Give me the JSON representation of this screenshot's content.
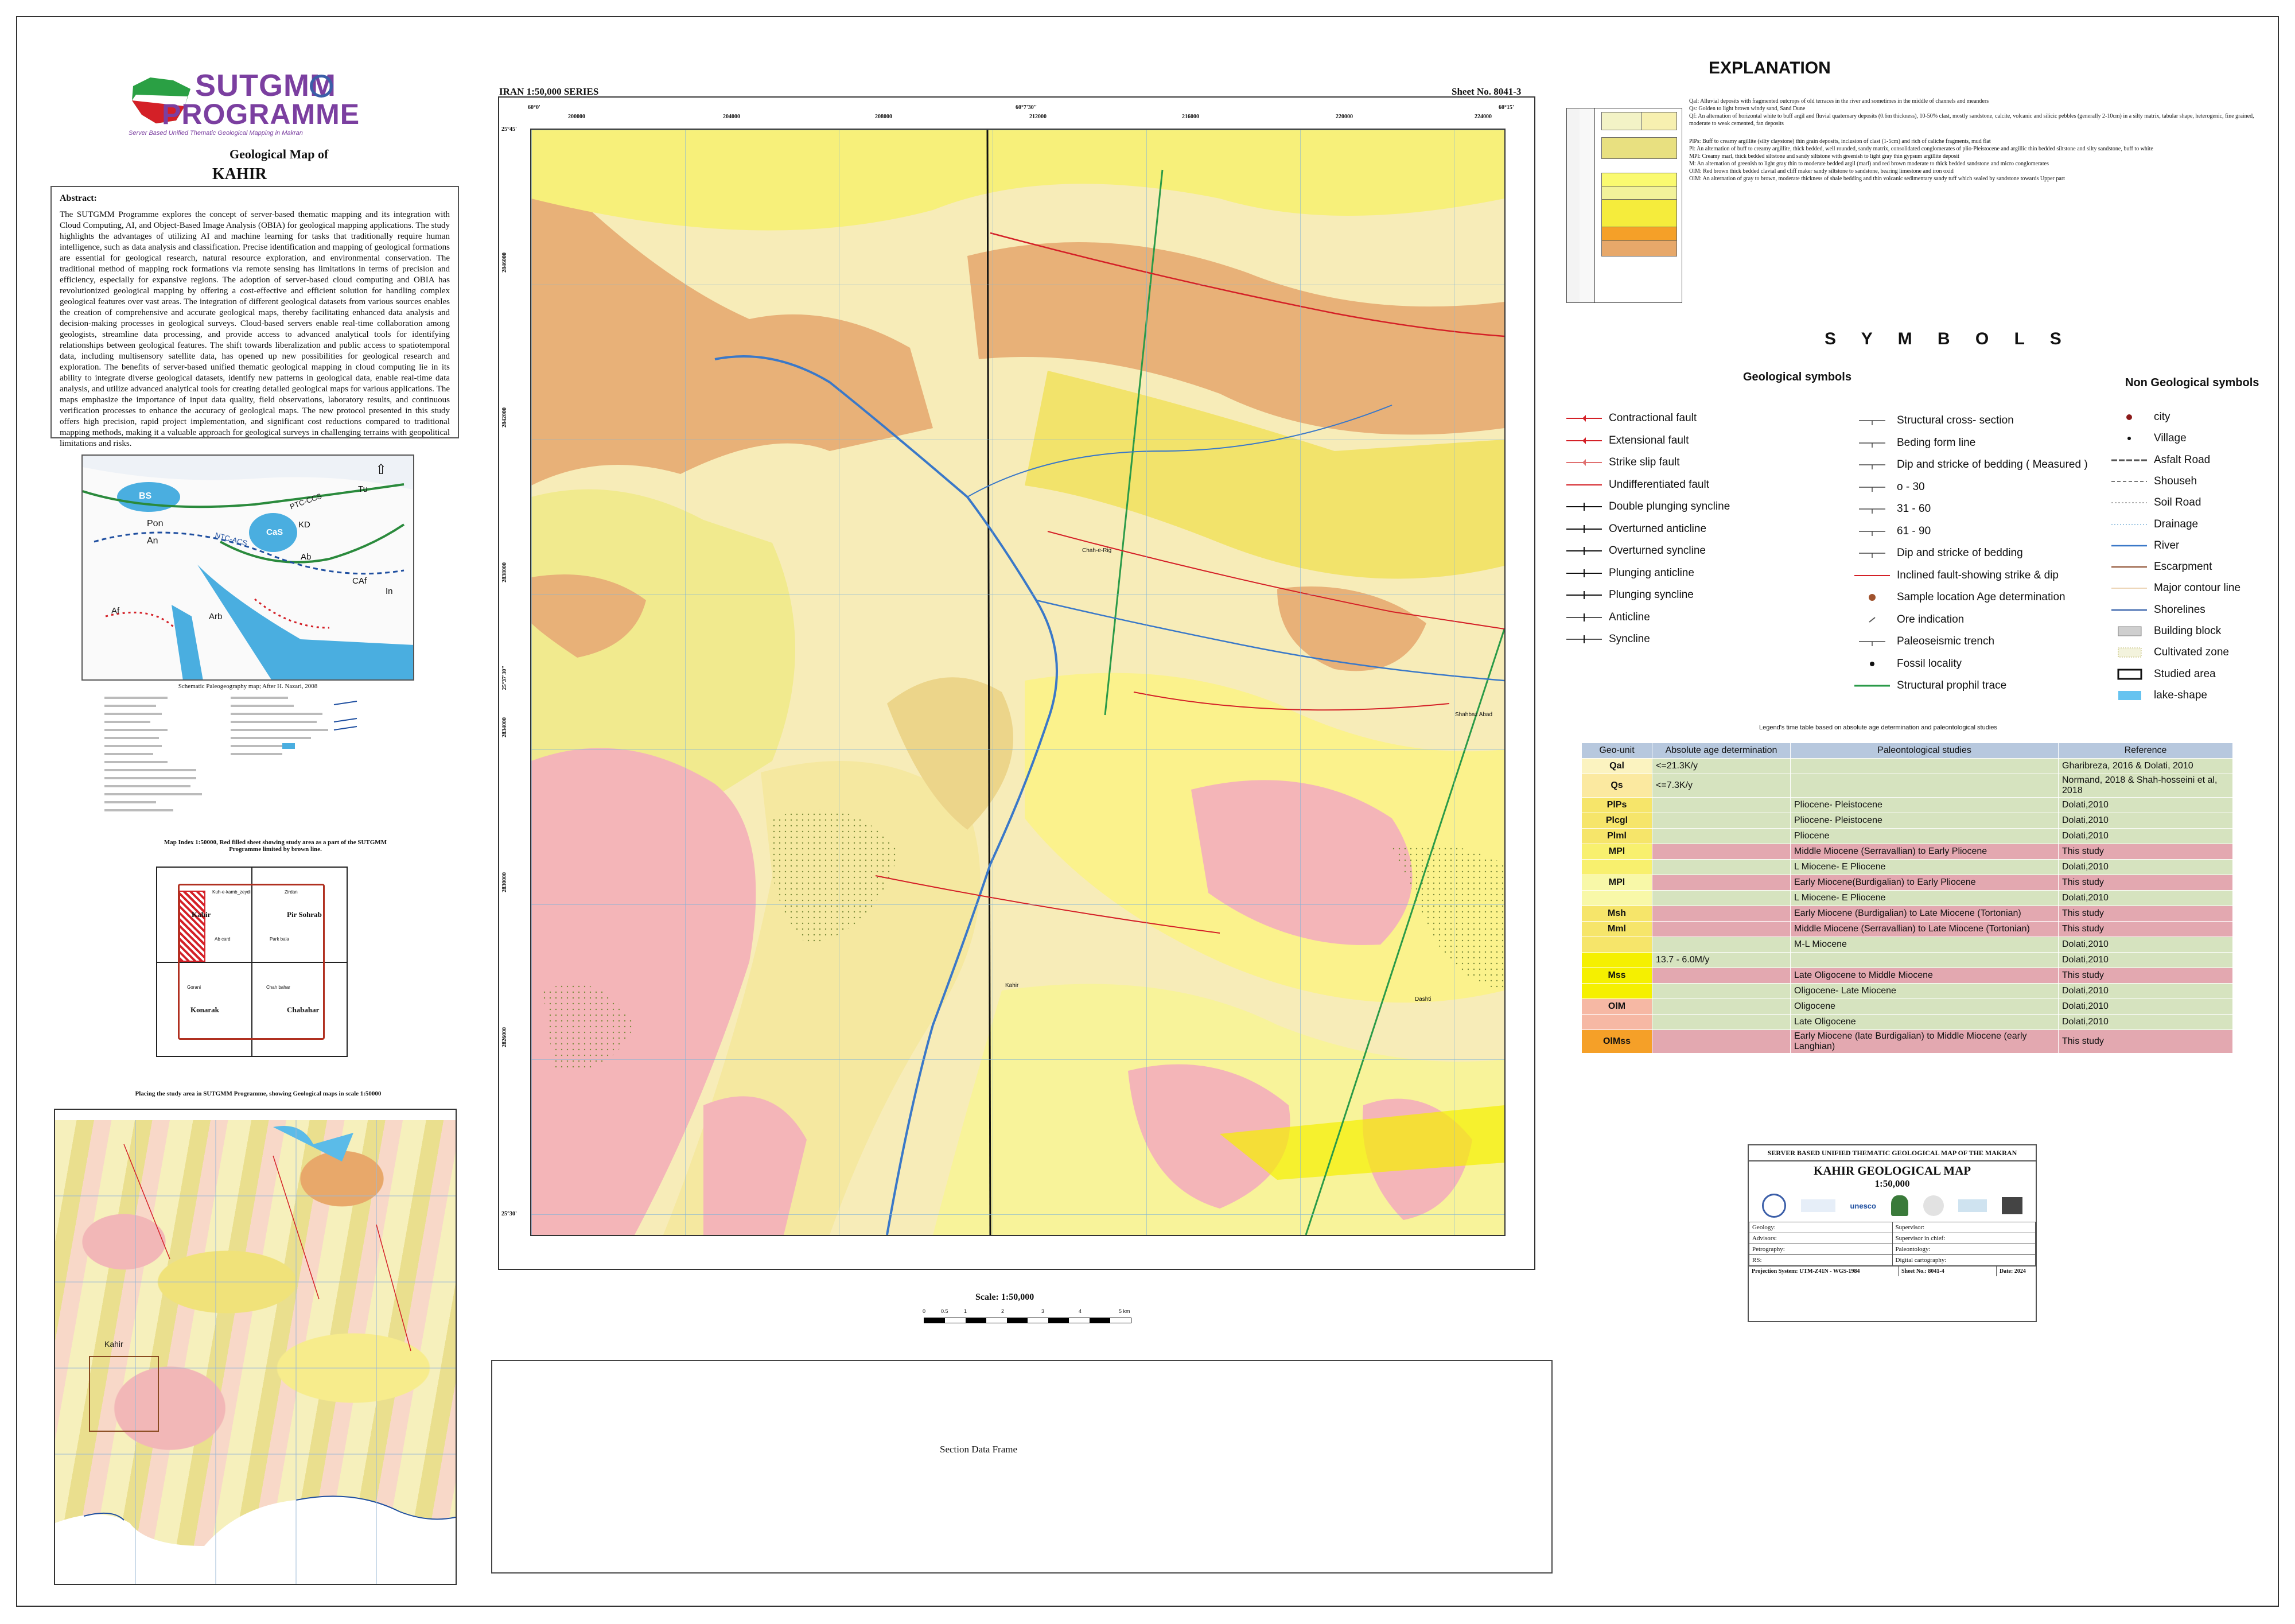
{
  "programme": {
    "logo_line1": "SUTGMM",
    "logo_line2": "PROGRAMME",
    "tagline": "Server Based Unified Thematic Geological Mapping in Makran"
  },
  "map_title": {
    "line1": "Geological Map of",
    "line2": "KAHIR"
  },
  "abstract": {
    "heading": "Abstract:",
    "text": "The SUTGMM Programme explores the concept of server-based thematic mapping and its integration with Cloud Computing, AI, and Object-Based Image Analysis (OBIA) for geological mapping applications. The study highlights the advantages of utilizing AI and machine learning for tasks that traditionally require human intelligence, such as data analysis and classification. Precise identification and mapping of geological formations are essential for geological research, natural resource exploration, and environmental conservation. The traditional method of mapping rock formations via remote sensing has limitations in terms of precision and efficiency, especially for expansive regions. The adoption of server-based cloud computing and OBIA has revolutionized geological mapping by offering a cost-effective and efficient solution for handling complex geological features over vast areas. The integration of different geological datasets from various sources enables the creation of comprehensive and accurate geological maps, thereby facilitating enhanced data analysis and decision-making processes in geological surveys. Cloud-based servers enable real-time collaboration among geologists, streamline data processing, and provide access to advanced analytical tools for identifying relationships between geological features. The shift towards liberalization and public access to spatiotemporal data, including multisensory satellite data, has opened up new possibilities for geological research and exploration. The benefits of server-based unified thematic geological mapping in cloud computing lie in its ability to integrate diverse geological datasets, identify new patterns in geological data, enable real-time data analysis, and utilize advanced analytical tools for creating detailed geological maps for various applications. The maps emphasize the importance of input data quality, field observations, laboratory results, and continuous verification processes to enhance the accuracy of geological maps. The new protocol presented in this study offers high precision, rapid project implementation, and significant cost reductions compared to traditional mapping methods, making it a valuable approach for geological surveys in challenging terrains with geopolitical limitations and risks."
  },
  "paleo_caption": "Schematic Paleogeography map; After H. Nazari, 2008",
  "paleo_labels": [
    "BS",
    "Pon",
    "An",
    "CaS",
    "KD",
    "Ab",
    "CAf",
    "Tu",
    "In",
    "Af",
    "Arb",
    "PTC-CCS",
    "NTC-ACS"
  ],
  "index_map": {
    "caption": "Map Index 1:50000, Red filled sheet showing study area as a part of the SUTGMM Programme limited by brown line.",
    "cells": [
      "Kahir",
      "Pir Sohrab",
      "Konarak",
      "Chabahar"
    ],
    "small_labels": [
      "Kuh-e-kamb_zeydi",
      "Zirdan",
      "Ab card",
      "Park bala",
      "Gorani",
      "Chah bahar"
    ]
  },
  "regional_caption": "Placing the study area in SUTGMM Programme, showing Geological maps in scale 1:50000",
  "regional_label": "Kahir",
  "map": {
    "series": "IRAN 1:50,000 SERIES",
    "sheet": "Sheet No. 8041-3",
    "top_ticks": [
      "60°0'",
      "200000",
      "204000",
      "208000",
      "60°7'30\"",
      "212000",
      "216000",
      "220000",
      "224000",
      "60°15'"
    ],
    "left_ticks": [
      "25°45'",
      "2846000",
      "2842000",
      "2838000",
      "25°37'30\"",
      "2834000",
      "2830000",
      "2826000",
      "25°30'"
    ],
    "scale": "Scale: 1:50,000",
    "scale_ticks": [
      "0",
      "0.5",
      "1",
      "2",
      "3",
      "4",
      "5 km"
    ],
    "places": [
      "Kahir",
      "Shahbaz Abad",
      "Chah-e-Rig",
      "Dashti"
    ]
  },
  "section_frame": "Section Data Frame",
  "explanation": {
    "title": "EXPLANATION",
    "units": [
      {
        "code": "Qal",
        "color": "#f3f3c6",
        "text": "Qal: Alluvial deposits with fragmented outcrops of old terraces in the river and sometimes in the middle of channels and meanders"
      },
      {
        "code": "Qs",
        "color": "#f7f0b0",
        "text": "Qs: Golden to light brown windy sand, Sand Dune"
      },
      {
        "code": "Qf",
        "color": "#fbf7d8",
        "text": "Qf: An alternation of horizontal white to buff argil and fluvial quaternary deposits (0.6m thickness), 10-50% clast, mostly sandstone, calcite, volcanic and silicic pebbles (generally 2-10cm) in a silty matrix, tabular shape, heterogenic, fine grained, moderate to weak cemented, fan deposits"
      },
      {
        "code": "PlPs",
        "color": "#e8e080",
        "text": "PlPs: Buff to creamy argillite (silty claystone) thin grain deposits, inclusion of clast (1-5cm) and rich of caliche fragments, mud flat"
      },
      {
        "code": "Pl",
        "color": "#fafa70",
        "text": "Pl: An alternation of buff to creamy argillite, thick bedded, well rounded, sandy matrix, consolidated conglomerates of plio-Pleistocene and argillic thin bedded siltstone and silty sandstone, buff to white"
      },
      {
        "code": "MPl",
        "color": "#f2f29a",
        "text": "MPl: Creamy marl, thick bedded siltstone and sandy siltstone with greenish to light gray thin gypsum argillite deposit"
      },
      {
        "code": "M",
        "color": "#f5ec3c",
        "text": "M: An alternation of greenish to light gray thin to moderate bedded argil (marl) and red brown moderate to thick bedded sandstone and micro conglomerates"
      },
      {
        "code": "OlM",
        "color": "#f5a028",
        "text": "OlM: Red brown thick bedded clavial and cliff maker sandy siltstone to sandstone, bearing limestone and iron oxid"
      },
      {
        "code": "OlMb",
        "color": "#e7a86a",
        "text": "OlM: An alternation of gray to brown, moderate thickness of shale bedding and thin volcanic sedimentary sandy tuff which sealed by sandstone towards Upper part"
      }
    ]
  },
  "symbols": {
    "title": "S Y M B O L S",
    "geo_heading": "Geological symbols",
    "nongeo_heading": "Non Geological symbols",
    "col1": [
      "Contractional fault",
      "Extensional fault",
      "Strike slip fault",
      "Undifferentiated fault",
      "Double plunging syncline",
      "Overturned anticline",
      "Overturned syncline",
      "Plunging anticline",
      "Plunging syncline",
      "Anticline",
      "Syncline"
    ],
    "col2": [
      "Structural cross- section",
      "Beding form line",
      "Dip and stricke of bedding ( Measured )",
      "o - 30",
      "31 - 60",
      "61 - 90",
      "Dip and stricke of bedding",
      "Inclined fault-showing strike & dip",
      "Sample location Age determination",
      "Ore indication",
      "Paleoseismic trench",
      "Fossil locality",
      "Structural prophil trace"
    ],
    "col3": [
      "city",
      "Village",
      "Asfalt Road",
      "Shouseh",
      "Soil Road",
      "Drainage",
      "River",
      "Escarpment",
      "Major contour line",
      "Shorelines",
      "Building block",
      "Cultivated zone",
      "Studied area",
      "lake-shape"
    ],
    "dip_value": "50",
    "section_marks": [
      "A",
      "A'"
    ]
  },
  "agetable": {
    "caption": "Legend's time table based on absolute age determination and paleontological studies",
    "headers": [
      "Geo-unit",
      "Absolute age determination",
      "Paleontological studies",
      "Reference"
    ],
    "rows": [
      {
        "unit": "Qal",
        "color": "#fbf3c0",
        "abs": "<=21.3K/y",
        "paleo": "",
        "ref": "Gharibreza, 2016 & Dolati, 2010",
        "shade": "g"
      },
      {
        "unit": "Qs",
        "color": "#fbe9a0",
        "abs": "<=7.3K/y",
        "paleo": "",
        "ref": "Normand, 2018 & Shah-hosseini et al, 2018",
        "shade": "g"
      },
      {
        "unit": "PlPs",
        "color": "#f6e56a",
        "abs": "",
        "paleo": "Pliocene- Pleistocene",
        "ref": "Dolati,2010",
        "shade": "g"
      },
      {
        "unit": "Plcgl",
        "color": "#f6e56a",
        "abs": "",
        "paleo": "Pliocene- Pleistocene",
        "ref": "Dolati,2010",
        "shade": "g"
      },
      {
        "unit": "Plml",
        "color": "#f6e56a",
        "abs": "",
        "paleo": "Pliocene",
        "ref": "Dolati,2010",
        "shade": "g"
      },
      {
        "unit": "MPl",
        "color": "#f8f06e",
        "abs": "",
        "paleo": "Middle Miocene (Serravallian) to Early Pliocene",
        "ref": "This study",
        "shade": "p"
      },
      {
        "unit": "",
        "color": "#f8f06e",
        "abs": "",
        "paleo": "L Miocene- E Pliocene",
        "ref": "Dolati,2010",
        "shade": "g"
      },
      {
        "unit": "MPl",
        "color": "#f8f8a8",
        "abs": "",
        "paleo": "Early Miocene(Burdigalian) to Early Pliocene",
        "ref": "This study",
        "shade": "p"
      },
      {
        "unit": "",
        "color": "#f8f8a8",
        "abs": "",
        "paleo": "L Miocene- E Pliocene",
        "ref": "Dolati,2010",
        "shade": "g"
      },
      {
        "unit": "Msh",
        "color": "#f6e56a",
        "abs": "",
        "paleo": "Early Miocene (Burdigalian) to Late Miocene (Tortonian)",
        "ref": "This study",
        "shade": "p"
      },
      {
        "unit": "Mml",
        "color": "#f6e56a",
        "abs": "",
        "paleo": "Middle Miocene (Serravallian) to Late Miocene (Tortonian)",
        "ref": "This study",
        "shade": "p"
      },
      {
        "unit": "",
        "color": "#f6e56a",
        "abs": "",
        "paleo": "M-L Miocene",
        "ref": "Dolati,2010",
        "shade": "g"
      },
      {
        "unit": "",
        "color": "#f5f000",
        "abs": "13.7 - 6.0M/y",
        "paleo": "",
        "ref": "Dolati,2010",
        "shade": "g"
      },
      {
        "unit": "Mss",
        "color": "#f5f000",
        "abs": "",
        "paleo": "Late Oligocene to Middle Miocene",
        "ref": "This study",
        "shade": "p"
      },
      {
        "unit": "",
        "color": "#f5f000",
        "abs": "",
        "paleo": "Oligocene- Late Miocene",
        "ref": "Dolati,2010",
        "shade": "g"
      },
      {
        "unit": "OlM",
        "color": "#f6b8a4",
        "abs": "",
        "paleo": "Oligocene",
        "ref": "Dolati,2010",
        "shade": "g"
      },
      {
        "unit": "",
        "color": "#f6b8a4",
        "abs": "",
        "paleo": "Late Oligocene",
        "ref": "Dolati,2010",
        "shade": "g"
      },
      {
        "unit": "OlMss",
        "color": "#f5a028",
        "abs": "",
        "paleo": "Early Miocene (late Burdigalian) to Middle Miocene (early Langhian)",
        "ref": "This study",
        "shade": "p"
      }
    ]
  },
  "titleblock": {
    "header": "SERVER BASED UNIFIED THEMATIC GEOLOGICAL MAP OF THE MAKRAN",
    "title": "KAHIR GEOLOGICAL MAP",
    "scale": "1:50,000",
    "fields_left": [
      "Geology:",
      "Advisors:",
      "Petrography:",
      "RS:"
    ],
    "fields_right": [
      "Supervisor:",
      "Supervisor in chief:",
      "Paleontology:",
      "Digital cartography:"
    ],
    "projection": "Projection System: UTM-Z41N - WGS-1984",
    "sheet": "Sheet No.: 8041-4",
    "date": "Date: 2024",
    "partners": [
      "unesco"
    ]
  },
  "colors": {
    "accent": "#7b3fa0",
    "table_header": "#b7c8de",
    "green_row": "#d6e3bf",
    "pink_row": "#e3a8b0"
  }
}
